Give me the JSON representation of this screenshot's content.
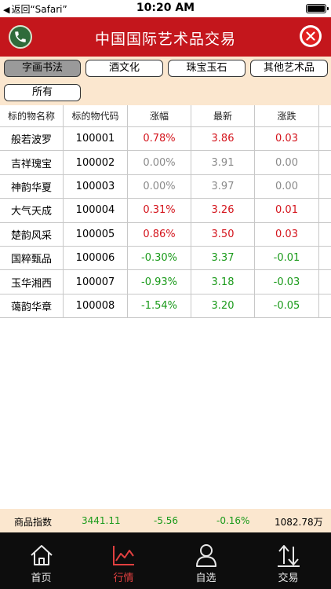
{
  "status_bar": {
    "back_label": "返回“Safari”",
    "time": "10:20 AM"
  },
  "header": {
    "title": "中国国际艺术品交易"
  },
  "categories": [
    {
      "label": "字画书法",
      "active": true
    },
    {
      "label": "酒文化",
      "active": false
    },
    {
      "label": "珠宝玉石",
      "active": false
    },
    {
      "label": "其他艺术品",
      "active": false
    },
    {
      "label": "所有",
      "active": false
    }
  ],
  "table": {
    "columns": [
      "标的物名称",
      "标的物代码",
      "涨幅",
      "最新",
      "涨跌"
    ],
    "rows": [
      {
        "name": "般若波罗",
        "code": "100001",
        "change_pct": "0.78%",
        "latest": "3.86",
        "change": "0.03",
        "trend": "up"
      },
      {
        "name": "吉祥瑰宝",
        "code": "100002",
        "change_pct": "0.00%",
        "latest": "3.91",
        "change": "0.00",
        "trend": "flat"
      },
      {
        "name": "神韵华夏",
        "code": "100003",
        "change_pct": "0.00%",
        "latest": "3.97",
        "change": "0.00",
        "trend": "flat"
      },
      {
        "name": "大气天成",
        "code": "100004",
        "change_pct": "0.31%",
        "latest": "3.26",
        "change": "0.01",
        "trend": "up"
      },
      {
        "name": "楚韵风采",
        "code": "100005",
        "change_pct": "0.86%",
        "latest": "3.50",
        "change": "0.03",
        "trend": "up"
      },
      {
        "name": "国粹甄品",
        "code": "100006",
        "change_pct": "-0.30%",
        "latest": "3.37",
        "change": "-0.01",
        "trend": "down"
      },
      {
        "name": "玉华湘西",
        "code": "100007",
        "change_pct": "-0.93%",
        "latest": "3.18",
        "change": "-0.03",
        "trend": "down"
      },
      {
        "name": "蔼韵华章",
        "code": "100008",
        "change_pct": "-1.54%",
        "latest": "3.20",
        "change": "-0.05",
        "trend": "down"
      }
    ]
  },
  "index_bar": {
    "label": "商品指数",
    "value": "3441.11",
    "change": "-5.56",
    "change_pct": "-0.16%",
    "volume": "1082.78万"
  },
  "tabs": [
    {
      "label": "首页",
      "icon": "home-icon",
      "active": false
    },
    {
      "label": "行情",
      "icon": "chart-icon",
      "active": true
    },
    {
      "label": "自选",
      "icon": "user-icon",
      "active": false
    },
    {
      "label": "交易",
      "icon": "trade-arrows-icon",
      "active": false
    }
  ],
  "colors": {
    "header": "#c4161c",
    "up": "#d4141c",
    "down": "#1a9a1a",
    "flat": "#8a8a8a",
    "panel": "#fbe7cf",
    "tabbar": "#0d0d0d",
    "tab_active": "#e24040"
  }
}
